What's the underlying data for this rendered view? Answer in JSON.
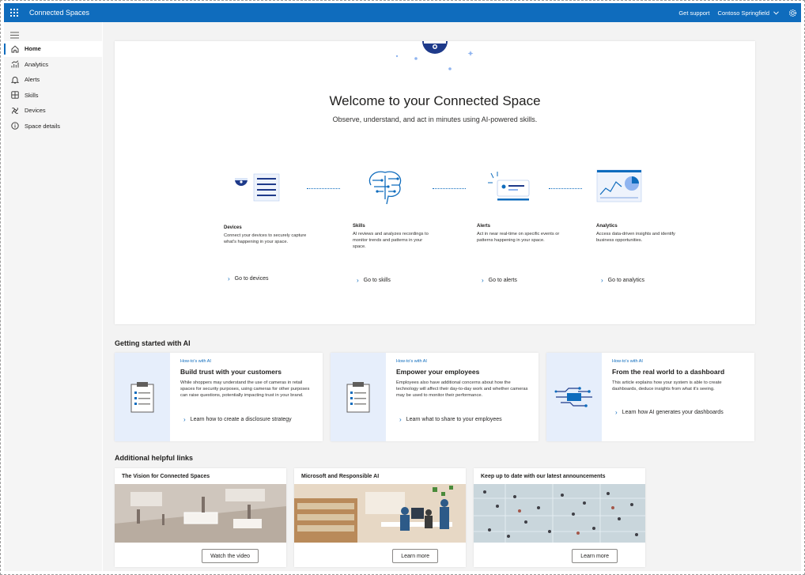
{
  "topbar": {
    "app_title": "Connected Spaces",
    "support": "Get support",
    "location": "Contoso Springfield",
    "icons": [
      "waffle-icon",
      "chevron-down-icon",
      "gear-icon"
    ]
  },
  "sidebar": {
    "items": [
      {
        "label": "Home",
        "icon": "home-icon",
        "active": true
      },
      {
        "label": "Analytics",
        "icon": "analytics-icon"
      },
      {
        "label": "Alerts",
        "icon": "bell-icon"
      },
      {
        "label": "Skills",
        "icon": "skills-icon"
      },
      {
        "label": "Devices",
        "icon": "devices-icon"
      },
      {
        "label": "Space details",
        "icon": "info-icon"
      }
    ]
  },
  "hero": {
    "title": "Welcome to your Connected Space",
    "subtitle": "Observe, understand, and act in minutes using AI-powered skills.",
    "steps": [
      {
        "title": "Devices",
        "desc": "Connect your devices to securely capture what's happening in your space.",
        "link": "Go to devices"
      },
      {
        "title": "Skills",
        "desc": "AI reviews and analyzes recordings to monitor trends and patterns in your space.",
        "link": "Go to skills"
      },
      {
        "title": "Alerts",
        "desc": "Act in near real-time on specific events or patterns happening in your space.",
        "link": "Go to alerts"
      },
      {
        "title": "Analytics",
        "desc": "Access data-driven insights and identify business opportunities.",
        "link": "Go to analytics"
      }
    ]
  },
  "getting_started": {
    "title": "Getting started with AI",
    "cards": [
      {
        "kicker": "How-to's with AI",
        "title": "Build trust with your customers",
        "desc": "While shoppers may understand the use of cameras in retail spaces for security purposes, using cameras for other purposes can raise questions, potentially impacting trust in your brand.",
        "link": "Learn how to create a disclosure strategy"
      },
      {
        "kicker": "How-to's with AI",
        "title": "Empower your employees",
        "desc": "Employees also have additional concerns about how the technology will affect their day-to-day work and whether cameras may be used to monitor their performance.",
        "link": "Learn what to share to your employees"
      },
      {
        "kicker": "How-to's with AI",
        "title": "From the real world to a dashboard",
        "desc": "This article explains how your system is able to create dashboards, deduce insights from what it's seeing.",
        "link": "Learn how AI generates your dashboards"
      }
    ]
  },
  "helpful_links": {
    "title": "Additional helpful links",
    "cards": [
      {
        "title": "The Vision for Connected Spaces",
        "button": "Watch the video"
      },
      {
        "title": "Microsoft and Responsible AI",
        "button": "Learn more"
      },
      {
        "title": "Keep up to date with our latest announcements",
        "button": "Learn more"
      }
    ]
  },
  "colors": {
    "brand": "#0f6cbd",
    "art_bg": "#e6eefb",
    "page_bg": "#f3f3f3"
  }
}
